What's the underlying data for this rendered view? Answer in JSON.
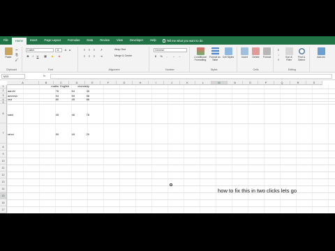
{
  "tabs": [
    "File",
    "Home",
    "Insert",
    "Page Layout",
    "Formulas",
    "Data",
    "Review",
    "View",
    "Developer",
    "Help"
  ],
  "tell_me": "Tell me what you want to do",
  "ribbon": {
    "clipboard": {
      "paste": "Paste",
      "label": "Clipboard"
    },
    "font": {
      "name": "Calibri",
      "size": "11",
      "label": "Font",
      "bold": "B",
      "italic": "I",
      "underline": "U"
    },
    "alignment": {
      "wrap": "Wrap Text",
      "merge": "Merge & Center",
      "label": "Alignment"
    },
    "number": {
      "format": "General",
      "label": "Number"
    },
    "styles": {
      "conditional": "Conditional Formatting",
      "table": "Format as Table",
      "cell": "Cell Styles",
      "label": "Styles"
    },
    "cells": {
      "insert": "Insert",
      "delete": "Delete",
      "format": "Format",
      "label": "Cells"
    },
    "editing": {
      "sort": "Sort & Filter",
      "find": "Find & Select",
      "label": "Editing"
    },
    "addins": {
      "label": "Add-ins"
    }
  },
  "formula_bar": {
    "name_box": "M15",
    "fx": "fx",
    "value": ""
  },
  "columns": [
    "A",
    "B",
    "C",
    "D",
    "E",
    "F",
    "G",
    "H",
    "I",
    "J",
    "K",
    "L",
    "M",
    "N",
    "O",
    "P",
    "Q",
    "R",
    "S"
  ],
  "selected_column": "M",
  "rows": [
    "1",
    "2",
    "3",
    "4",
    "5",
    "",
    "",
    "",
    "",
    "",
    "",
    "",
    "",
    "",
    "",
    "",
    "",
    "",
    ""
  ],
  "row_numbers": [
    "1",
    "2",
    "3",
    "4",
    "5",
    "6",
    "7",
    "8",
    "9",
    "10",
    "11",
    "12",
    "13",
    "14",
    "15",
    "16",
    "17",
    "18"
  ],
  "selected_row": "15",
  "headers": {
    "b": "maths",
    "c": "English",
    "d": "chemistry"
  },
  "data_rows": [
    {
      "name": "aarohi",
      "maths": "76",
      "english": "54",
      "chemistry": "45"
    },
    {
      "name": "ameesh",
      "maths": "94",
      "english": "59",
      "chemistry": "98"
    },
    {
      "name": "ravi",
      "maths": "80",
      "english": "45",
      "chemistry": "86"
    },
    {
      "name": "sami",
      "maths": "45",
      "english": "46",
      "chemistry": "78"
    },
    {
      "name": "rahul",
      "maths": "50",
      "english": "40",
      "chemistry": "20"
    }
  ],
  "caption": "how to fix this in two clicks lets go"
}
